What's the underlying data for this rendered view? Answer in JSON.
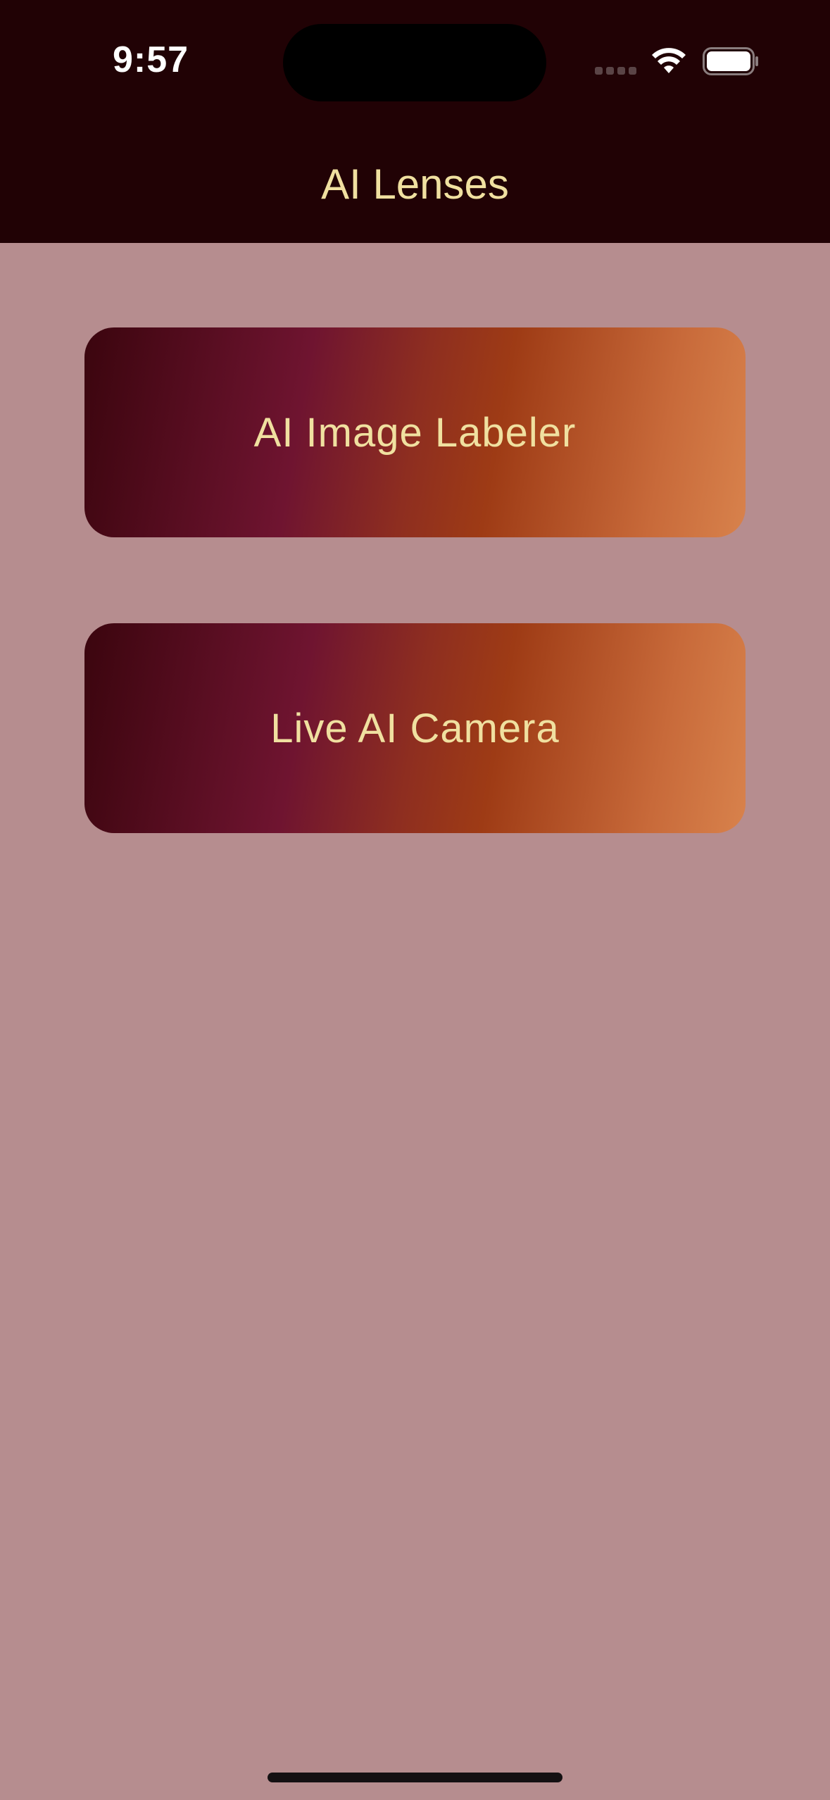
{
  "status_bar": {
    "time": "9:57",
    "wifi_icon": "wifi-icon",
    "battery_icon": "battery-icon",
    "signal_icon": "cellular-signal-icon"
  },
  "nav": {
    "title": "AI Lenses"
  },
  "menu": {
    "items": [
      {
        "label": "AI Image Labeler"
      },
      {
        "label": "Live AI Camera"
      }
    ]
  },
  "colors": {
    "header_bg": "#210205",
    "page_bg": "#b68d8f",
    "text_accent": "#f0e0a0",
    "gradient_start": "#3b050e",
    "gradient_mid": "#6f1430",
    "gradient_orange": "#9e3b15",
    "gradient_end": "#d8824c"
  }
}
